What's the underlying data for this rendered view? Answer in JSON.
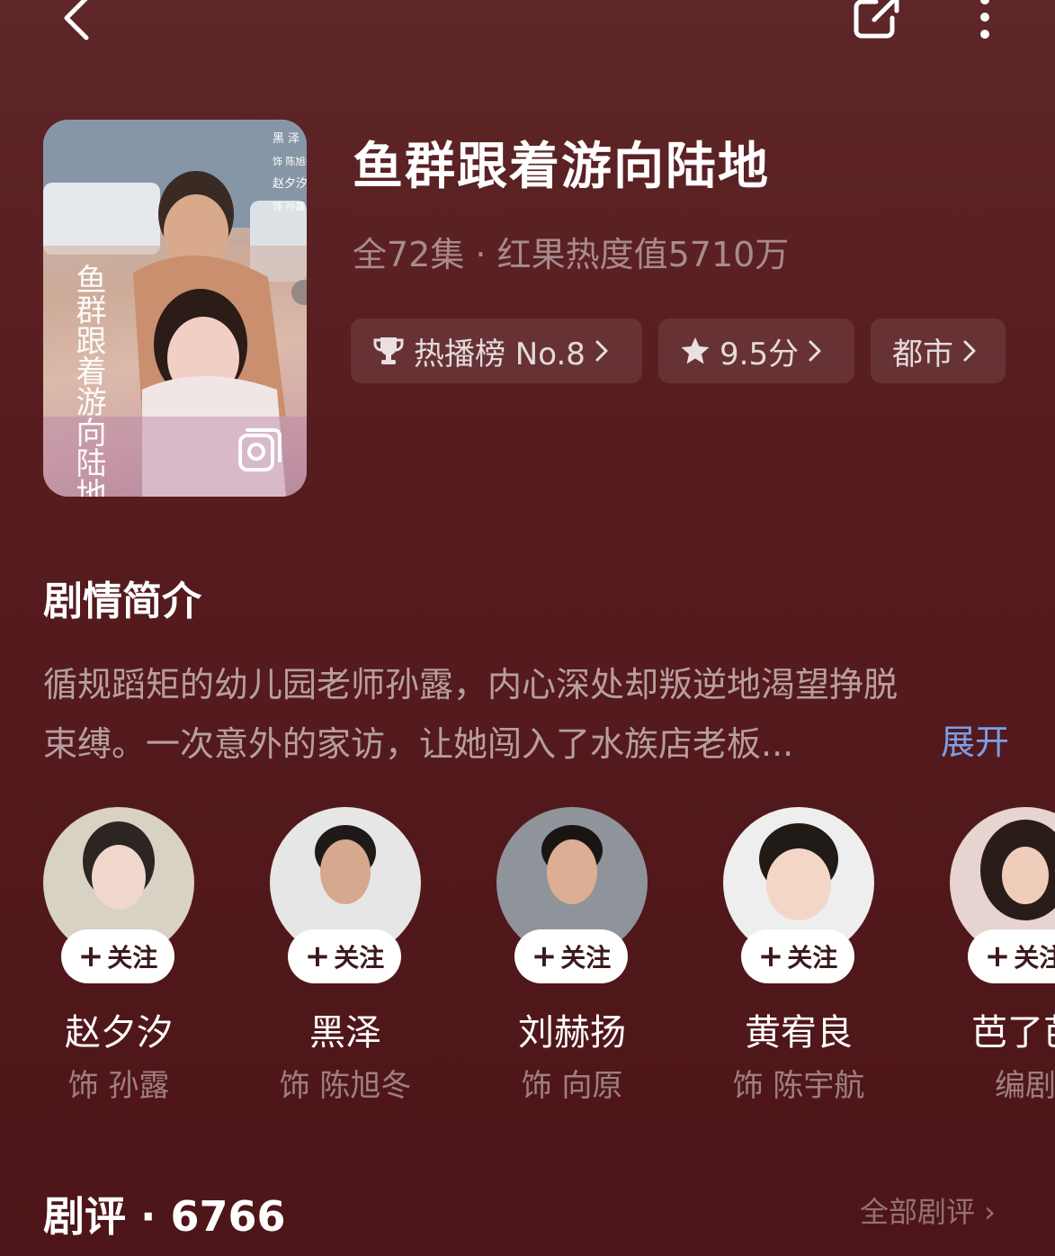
{
  "header": {
    "back_icon": "chevron-left-icon",
    "share_icon": "share-icon",
    "more_icon": "more-vertical-icon"
  },
  "drama": {
    "title": "鱼群跟着游向陆地",
    "meta": "全72集 · 红果热度值5710万",
    "poster_text": "鱼群跟着游向陆地",
    "poster_credits": [
      "黑 泽",
      "饰 陈旭冬",
      "赵夕汐",
      "饰 孙露"
    ],
    "poster_icon": "gallery-icon"
  },
  "tags": [
    {
      "icon": "trophy-icon",
      "label": "热播榜 No.8"
    },
    {
      "icon": "star-icon",
      "label": "9.5分"
    },
    {
      "icon": "",
      "label": "都市"
    }
  ],
  "synopsis": {
    "title": "剧情简介",
    "line1": "循规蹈矩的幼儿园老师孙露，内心深处却叛逆地渴望挣脱",
    "line2": "束缚。一次意外的家访，让她闯入了水族店老板...",
    "expand_label": "展开"
  },
  "cast": [
    {
      "name": "赵夕汐",
      "role": "饰 孙露",
      "follow_label": "关注"
    },
    {
      "name": "黑泽",
      "role": "饰 陈旭冬",
      "follow_label": "关注"
    },
    {
      "name": "刘赫扬",
      "role": "饰 向原",
      "follow_label": "关注"
    },
    {
      "name": "黄宥良",
      "role": "饰 陈宇航",
      "follow_label": "关注"
    },
    {
      "name": "芭了芭",
      "role": "编剧",
      "follow_label": "关注"
    }
  ],
  "reviews": {
    "title": "剧评 · 6766",
    "all_label": "全部剧评 ›"
  },
  "colors": {
    "background": "#5a1f22",
    "accent_link": "#7aa0ea",
    "pill_bg": "rgba(255,255,255,0.09)"
  }
}
